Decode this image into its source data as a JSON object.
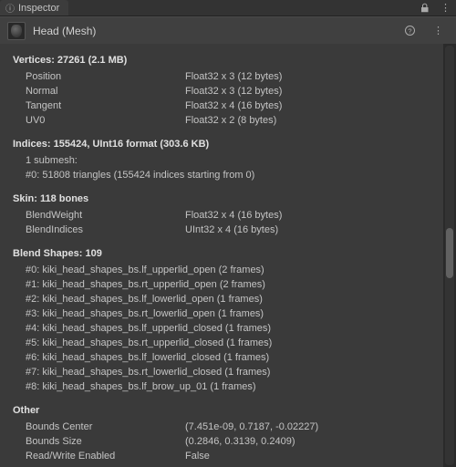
{
  "tab": {
    "title": "Inspector"
  },
  "object": {
    "name": "Head (Mesh)"
  },
  "vertices": {
    "heading": "Vertices: 27261 (2.1 MB)",
    "rows": [
      {
        "label": "Position",
        "value": "Float32 x 3 (12 bytes)"
      },
      {
        "label": "Normal",
        "value": "Float32 x 3 (12 bytes)"
      },
      {
        "label": "Tangent",
        "value": "Float32 x 4 (16 bytes)"
      },
      {
        "label": "UV0",
        "value": "Float32 x 2 (8 bytes)"
      }
    ]
  },
  "indices": {
    "heading": "Indices: 155424, UInt16 format (303.6 KB)",
    "lines": [
      "1 submesh:",
      "#0: 51808 triangles (155424 indices starting from 0)"
    ]
  },
  "skin": {
    "heading": "Skin: 118 bones",
    "rows": [
      {
        "label": "BlendWeight",
        "value": "Float32 x 4 (16 bytes)"
      },
      {
        "label": "BlendIndices",
        "value": "UInt32 x 4 (16 bytes)"
      }
    ]
  },
  "blendshapes": {
    "heading": "Blend Shapes: 109",
    "lines": [
      "#0: kiki_head_shapes_bs.lf_upperlid_open (2 frames)",
      "#1: kiki_head_shapes_bs.rt_upperlid_open (2 frames)",
      "#2: kiki_head_shapes_bs.lf_lowerlid_open (1 frames)",
      "#3: kiki_head_shapes_bs.rt_lowerlid_open (1 frames)",
      "#4: kiki_head_shapes_bs.lf_upperlid_closed (1 frames)",
      "#5: kiki_head_shapes_bs.rt_upperlid_closed (1 frames)",
      "#6: kiki_head_shapes_bs.lf_lowerlid_closed (1 frames)",
      "#7: kiki_head_shapes_bs.rt_lowerlid_closed (1 frames)",
      "#8: kiki_head_shapes_bs.lf_brow_up_01 (1 frames)"
    ]
  },
  "other": {
    "heading": "Other",
    "rows": [
      {
        "label": "Bounds Center",
        "value": "(7.451e-09, 0.7187, -0.02227)"
      },
      {
        "label": "Bounds Size",
        "value": "(0.2846, 0.3139, 0.2409)"
      },
      {
        "label": "Read/Write Enabled",
        "value": "False"
      }
    ]
  }
}
